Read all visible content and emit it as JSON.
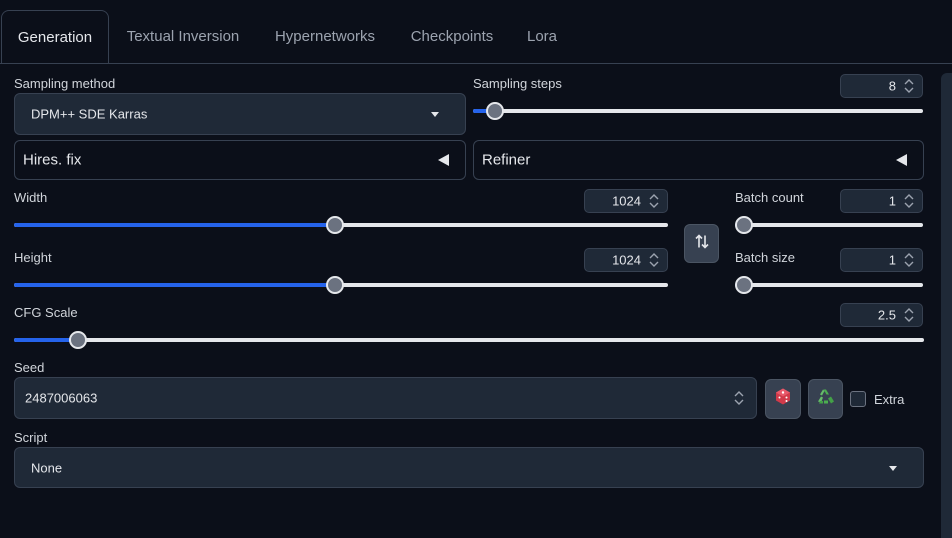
{
  "tabs": [
    {
      "label": "Generation",
      "active": true
    },
    {
      "label": "Textual Inversion",
      "active": false
    },
    {
      "label": "Hypernetworks",
      "active": false
    },
    {
      "label": "Checkpoints",
      "active": false
    },
    {
      "label": "Lora",
      "active": false
    }
  ],
  "sampling_method": {
    "label": "Sampling method",
    "value": "DPM++ SDE Karras"
  },
  "sampling_steps": {
    "label": "Sampling steps",
    "value": "8",
    "fraction": 0.03
  },
  "hires_fix": {
    "label": "Hires. fix"
  },
  "refiner": {
    "label": "Refiner"
  },
  "width": {
    "label": "Width",
    "value": "1024",
    "fraction": 0.49
  },
  "height": {
    "label": "Height",
    "value": "1024",
    "fraction": 0.49
  },
  "batch_count": {
    "label": "Batch count",
    "value": "1",
    "fraction": 0.0
  },
  "batch_size": {
    "label": "Batch size",
    "value": "1",
    "fraction": 0.0
  },
  "cfg_scale": {
    "label": "CFG Scale",
    "value": "2.5",
    "fraction": 0.062
  },
  "seed": {
    "label": "Seed",
    "value": "2487006063",
    "extra_label": "Extra"
  },
  "script": {
    "label": "Script",
    "value": "None"
  },
  "icons": {
    "swap": "swap-dimensions-icon",
    "random": "dice-icon",
    "reuse": "recycle-icon"
  },
  "colors": {
    "accent": "#2563eb",
    "background": "#0b0f19",
    "panel": "#1f2937",
    "border": "#374151"
  }
}
